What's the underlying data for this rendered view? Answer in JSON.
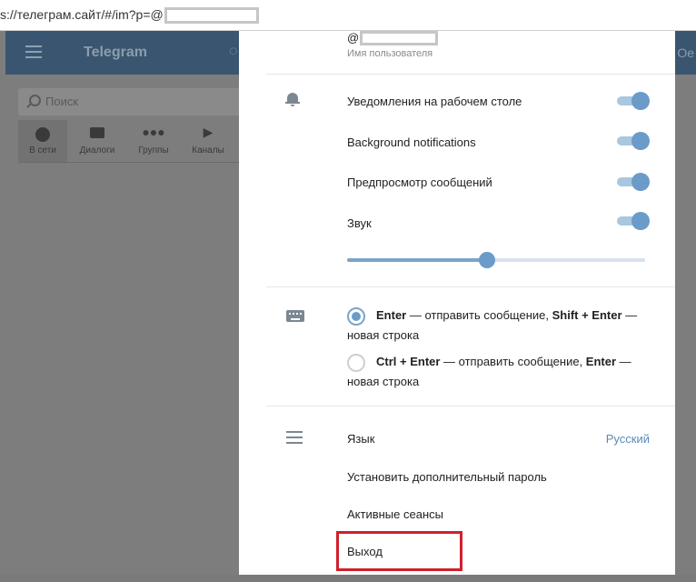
{
  "browser": {
    "url_text": "s://телеграм.сайт/#/im?p=@"
  },
  "app": {
    "title": "Telegram",
    "right_text": "Oe",
    "search_placeholder": "Поиск",
    "tabs": [
      {
        "label": "В сети",
        "icon": "online-icon",
        "active": true
      },
      {
        "label": "Диалоги",
        "icon": "chat-bubble-icon",
        "active": false
      },
      {
        "label": "Группы",
        "icon": "group-icon",
        "active": false
      },
      {
        "label": "Каналы",
        "icon": "megaphone-icon",
        "active": false
      }
    ]
  },
  "settings": {
    "username_prefix": "@",
    "username_label": "Имя пользователя",
    "notifications": {
      "desktop_label": "Уведомления на рабочем столе",
      "desktop_on": true,
      "background_label": "Background notifications",
      "background_on": true,
      "preview_label": "Предпросмотр сообщений",
      "preview_on": true,
      "sound_label": "Звук",
      "sound_on": true,
      "volume_fraction": 0.47
    },
    "send_mode": {
      "option1_key": "Enter",
      "option1_mid": " — отправить сообщение, ",
      "option1_key2": "Shift + Enter",
      "option1_tail": " — новая строка",
      "option1_checked": true,
      "option2_key": "Ctrl + Enter",
      "option2_mid": " — отправить сообщение, ",
      "option2_key2": "Enter",
      "option2_tail": " — новая строка",
      "option2_checked": false
    },
    "language_label": "Язык",
    "language_value": "Русский",
    "password_label": "Установить дополнительный пароль",
    "sessions_label": "Активные сеансы",
    "logout_label": "Выход"
  },
  "colors": {
    "accent": "#6b9bc9",
    "toggle_track": "#a9c7de",
    "link": "#5b8ab8",
    "highlight": "#d0202b"
  }
}
